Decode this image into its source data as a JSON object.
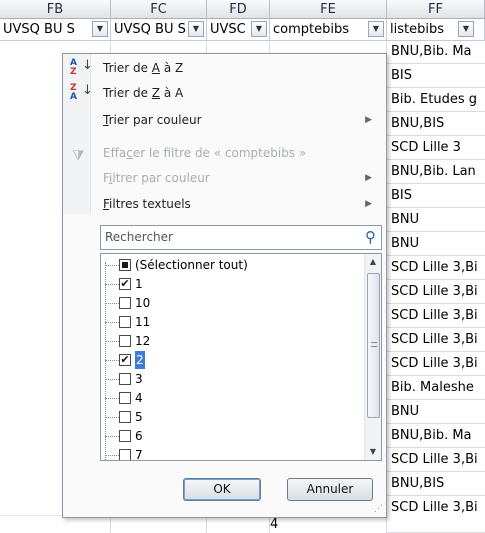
{
  "columns": [
    "FB",
    "FC",
    "FD",
    "FE",
    "FF"
  ],
  "header_cells": [
    "UVSQ BU S",
    "UVSQ BU S",
    "UVSC",
    "comptebibs",
    "listebibs"
  ],
  "ff_values": [
    "BNU,Bib. Ma",
    "BIS",
    "Bib. Etudes g",
    "BNU,BIS",
    "SCD Lille 3",
    "BNU,Bib. Lan",
    "BIS",
    "BNU",
    "BNU",
    "SCD Lille 3,Bi",
    "SCD Lille 3,Bi",
    "SCD Lille 3,Bi",
    "SCD Lille 3,Bi",
    "SCD Lille 3,Bi",
    "Bib. Maleshe",
    "BNU",
    "BNU,Bib. Ma",
    "SCD Lille 3,Bi",
    "BNU,BIS",
    "SCD Lille 3,Bi"
  ],
  "fe_visible_value": "4",
  "menu": {
    "sort_asc": {
      "pre": "Trier de ",
      "key": "A",
      "post": " à Z"
    },
    "sort_desc": {
      "pre": "Trier de ",
      "key": "Z",
      "post": " à A"
    },
    "sort_color": {
      "key": "T",
      "rest": "rier par couleur"
    },
    "clear_filter": {
      "pre": "Effa",
      "key": "c",
      "post": "er le filtre de « comptebibs »"
    },
    "filter_color": {
      "pre": "F",
      "key": "i",
      "post": "ltrer par couleur"
    },
    "text_filters": {
      "key": "F",
      "rest": "iltres textuels"
    },
    "search_placeholder": "Rechercher",
    "items": [
      {
        "label": "(Sélectionner tout)",
        "state": "partial"
      },
      {
        "label": "1",
        "state": "checked"
      },
      {
        "label": "10",
        "state": "unchecked"
      },
      {
        "label": "11",
        "state": "unchecked"
      },
      {
        "label": "12",
        "state": "unchecked"
      },
      {
        "label": "2",
        "state": "checked",
        "highlight": true
      },
      {
        "label": "3",
        "state": "unchecked"
      },
      {
        "label": "4",
        "state": "unchecked"
      },
      {
        "label": "5",
        "state": "unchecked"
      },
      {
        "label": "6",
        "state": "unchecked"
      },
      {
        "label": "7",
        "state": "unchecked"
      }
    ],
    "ok_label": "OK",
    "cancel_label": "Annuler"
  },
  "icons": {
    "sort_asc": "sort-a-z-icon",
    "sort_desc": "sort-z-a-icon",
    "clear_filter": "clear-filter-icon",
    "search": "search-icon",
    "dropdown": "filter-dropdown-icon"
  },
  "colors": {
    "header_bg": "#dfe3e8",
    "selection": "#3b7dd8",
    "disabled_text": "#a7adb5"
  }
}
